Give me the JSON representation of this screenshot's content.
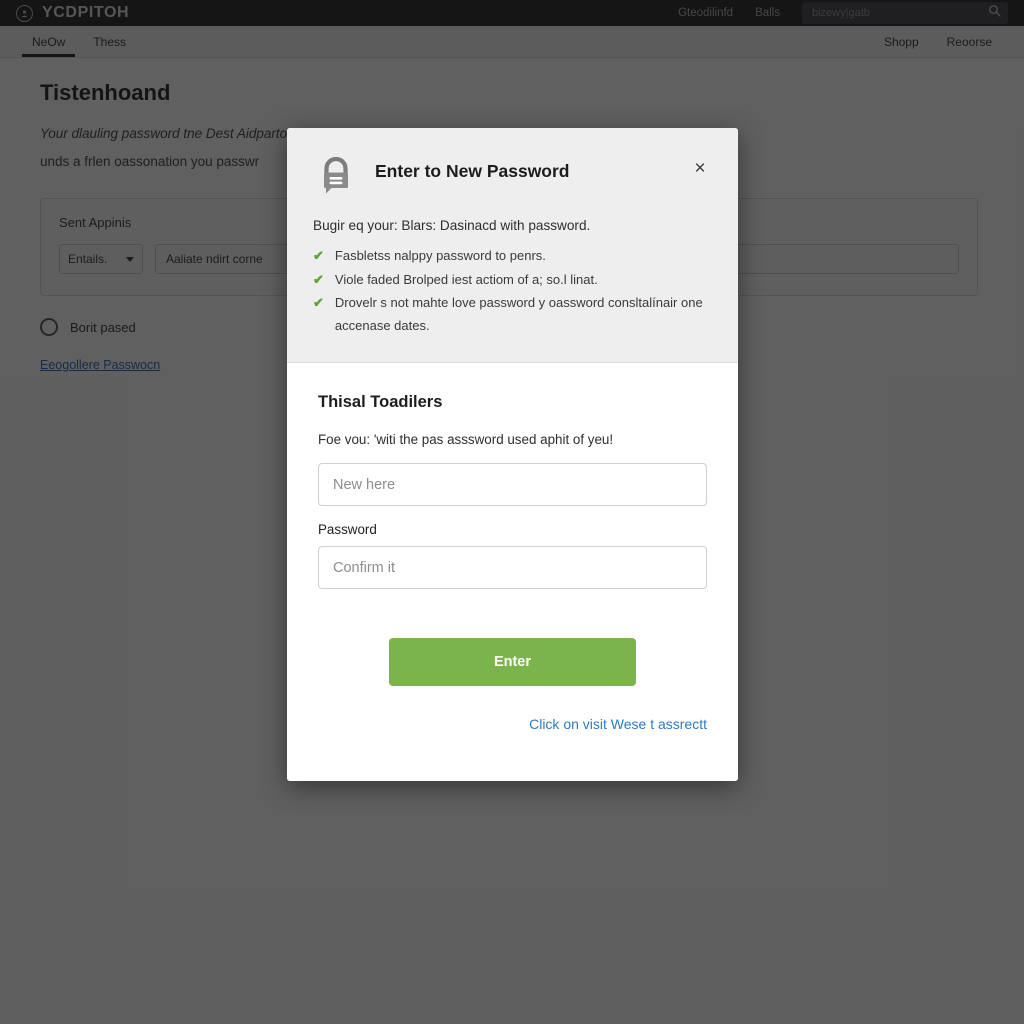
{
  "background": {
    "topbar": {
      "brand_name": "YCDPITOH",
      "brand_icon": "circle-badge-icon",
      "links": [
        "Gteodilinfd",
        "Balls"
      ],
      "search_placeholder": "bizewy|gatb",
      "search_icon": "search-icon"
    },
    "subnav": {
      "left_items": [
        {
          "label": "NeOw",
          "active": true
        },
        {
          "label": "Thess",
          "active": false
        }
      ],
      "right_items": [
        {
          "label": "Shopp",
          "active": false
        },
        {
          "label": "Reoorse",
          "active": false
        }
      ]
    },
    "page_title": "Tistenhoand",
    "page_sub_line1": "Your dlauling password tne Dest Aidparton Anuon ladan siros, and aaod Idaro roodinsed",
    "page_sub_line2": "unds a frlen oassonation you passwr",
    "panel": {
      "label": "Sent Appinis",
      "select_value": "Entails.",
      "select_caret": "chevron-down-icon",
      "field_value": "Aaliate ndirt corne"
    },
    "radio": {
      "icon": "radio-unchecked-icon",
      "label": "Borit pased"
    },
    "footer_link": "Eeogollere Passwocn"
  },
  "modal": {
    "lock_icon": "padlock-icon",
    "title": "Enter to New Password",
    "close_icon": "close-icon",
    "close_label": "×",
    "description": "Bugir eq your: Blars: Dasinacd with password.",
    "requirement_icon": "check-icon",
    "requirement_glyph": "✔",
    "requirements": [
      "Fasbletss nalppy password to penrs.",
      "Viole faded Brolped iest actiom of a; so.l linat.",
      "Drovelr s not mahte love password у oassword consltalínair one accenase dates."
    ],
    "body_title": "Thisal Toadilers",
    "body_description": "Foe vou: 'witi the pas aѕssword used aphit of yeu!",
    "new_password_placeholder": "New here",
    "new_password_value": "",
    "password_label": "Password",
    "confirm_placeholder": "Confirm it",
    "confirm_value": "",
    "submit_label": "Enter",
    "help_link": "Click on visit Wese t assrectt",
    "accent_green": "#7ab44a",
    "link_blue": "#2a7bc4",
    "check_green": "#5aa832"
  }
}
